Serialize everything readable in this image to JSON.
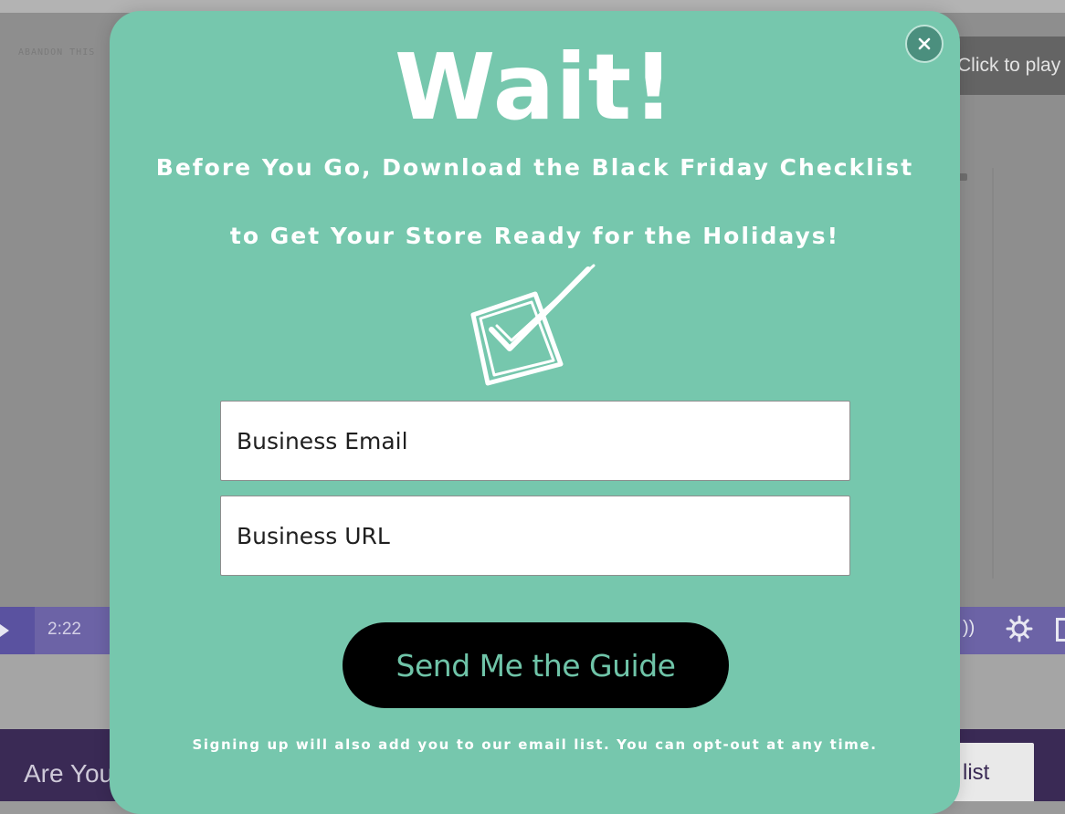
{
  "background": {
    "video": {
      "header_text": "ABANDON THIS",
      "overlay_label": "Click to play",
      "time": "2:22",
      "volume_icon": "volume-icon",
      "settings_icon": "gear-icon",
      "fullscreen_icon": "fullscreen-icon"
    },
    "banner": {
      "heading": "Are You",
      "button_label": "list"
    }
  },
  "popup": {
    "close_icon": "close-icon",
    "title": "Wait!",
    "subtitle_line1": "Before You Go, Download the Black Friday Checklist",
    "subtitle_line2": "to Get Your Store Ready for the Holidays!",
    "illustration_icon": "checkbox-check-icon",
    "email_field": {
      "placeholder": "Business Email",
      "value": ""
    },
    "url_field": {
      "placeholder": "Business URL",
      "value": ""
    },
    "submit_label": "Send Me the Guide",
    "disclaimer": "Signing up will also add you to our email list. You can opt-out at any time.",
    "colors": {
      "popup_bg": "#76c7ad",
      "button_bg": "#000000",
      "button_text": "#6fc4a8",
      "text": "#ffffff"
    }
  }
}
